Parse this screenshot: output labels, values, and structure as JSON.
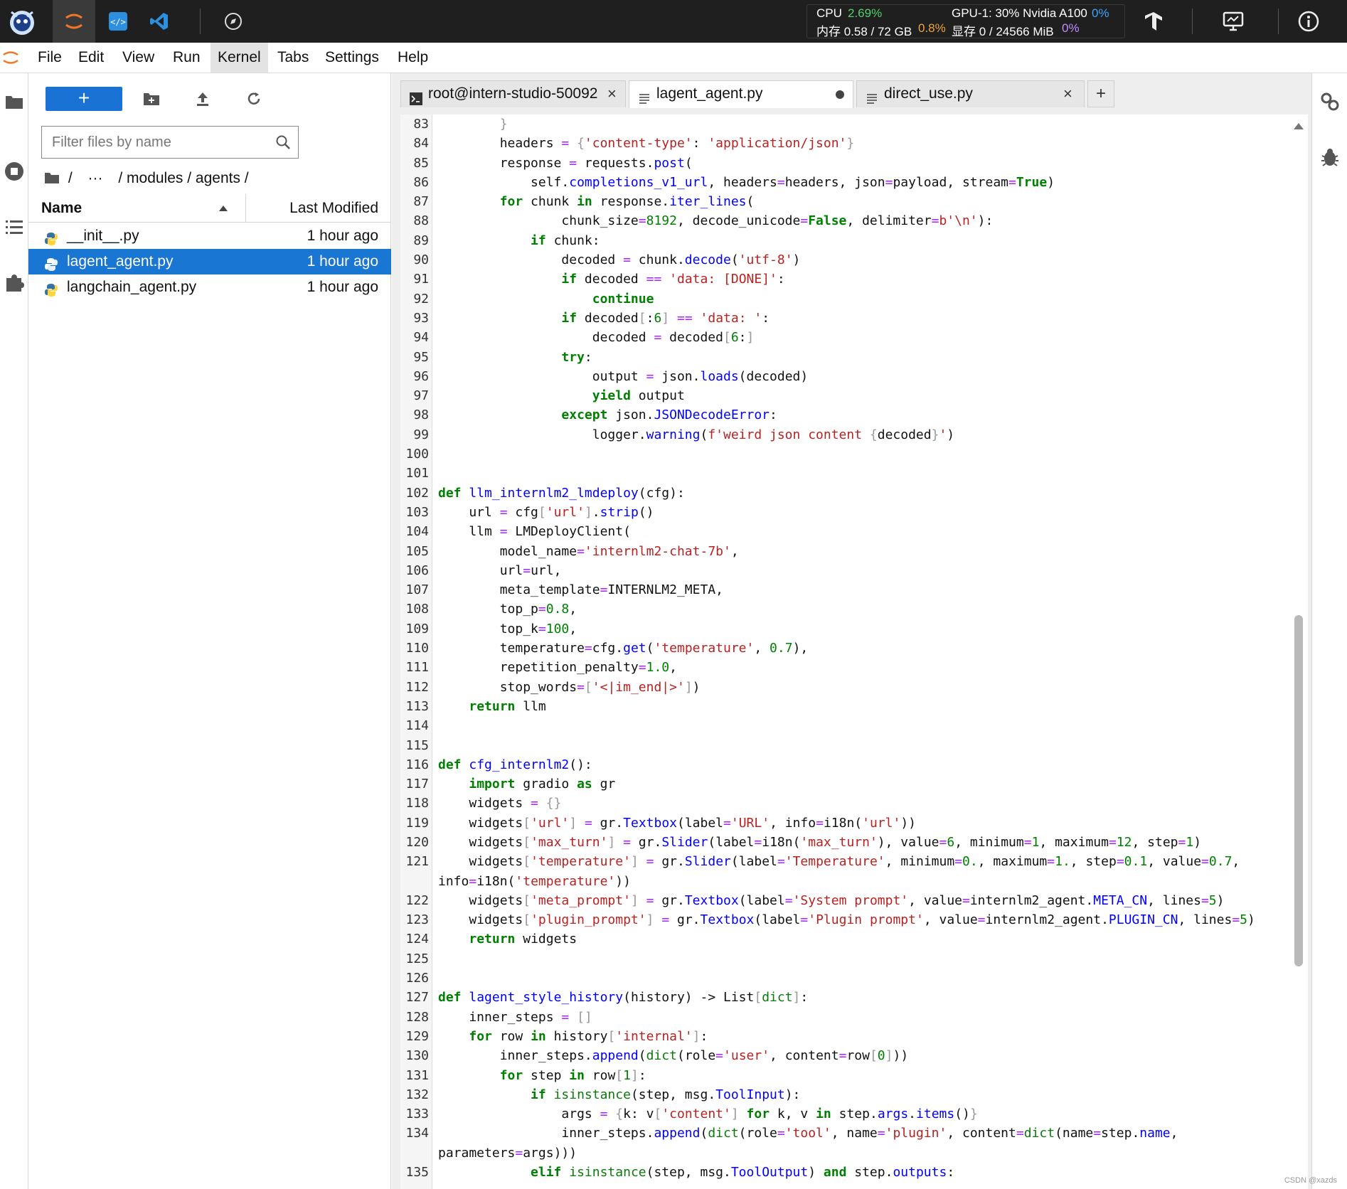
{
  "topbar": {
    "cpu_label": "CPU",
    "cpu_value": "2.69%",
    "mem_label": "内存 0.58 / 72 GB",
    "mem_value": "0.8%",
    "gpu_label": "GPU-1: 30% Nvidia A100",
    "gpu_value": "0%",
    "vram_label": "显存 0 / 24566 MiB",
    "vram_value": "0%",
    "icons": [
      "intern-logo-icon",
      "jupyter-icon",
      "code-server-icon",
      "vscode-icon",
      "compass-icon",
      "tensorflow-icon",
      "monitor-icon",
      "info-icon"
    ]
  },
  "menu": {
    "items": [
      "File",
      "Edit",
      "View",
      "Run",
      "Kernel",
      "Tabs",
      "Settings",
      "Help"
    ],
    "active": "Kernel"
  },
  "filebrowser": {
    "new_button": "+",
    "filter_placeholder": "Filter files by name",
    "breadcrumb": [
      "/",
      "···",
      "/ modules / agents /"
    ],
    "col_name": "Name",
    "col_modified": "Last Modified",
    "files": [
      {
        "name": "__init__.py",
        "modified": "1 hour ago"
      },
      {
        "name": "lagent_agent.py",
        "modified": "1 hour ago"
      },
      {
        "name": "langchain_agent.py",
        "modified": "1 hour ago"
      }
    ],
    "selected_index": 1
  },
  "tabs": [
    {
      "label": "root@intern-studio-50092",
      "kind": "terminal",
      "close": "×"
    },
    {
      "label": "lagent_agent.py",
      "kind": "file",
      "modified": true
    },
    {
      "label": "direct_use.py",
      "kind": "file",
      "close": "×"
    }
  ],
  "add_tab": "+",
  "editor": {
    "line_numbers": [
      "83",
      "84",
      "85",
      "86",
      "87",
      "88",
      "89",
      "90",
      "91",
      "92",
      "93",
      "94",
      "95",
      "96",
      "97",
      "98",
      "99",
      "100",
      "101",
      "102",
      "103",
      "104",
      "105",
      "106",
      "107",
      "108",
      "109",
      "110",
      "111",
      "112",
      "113",
      "114",
      "115",
      "116",
      "117",
      "118",
      "119",
      "120",
      "121",
      "",
      "122",
      "123",
      "124",
      "125",
      "126",
      "127",
      "128",
      "129",
      "130",
      "131",
      "132",
      "133",
      "134",
      "",
      "135"
    ]
  },
  "colors": {
    "topbar_bg": "#1f1f1f",
    "selection_blue": "#1976d2",
    "new_button_blue": "#1a73d4",
    "keyword_green": "#008000",
    "string_red": "#ba2121",
    "function_blue": "#0000ff"
  },
  "watermark": "CSDN @xazds"
}
